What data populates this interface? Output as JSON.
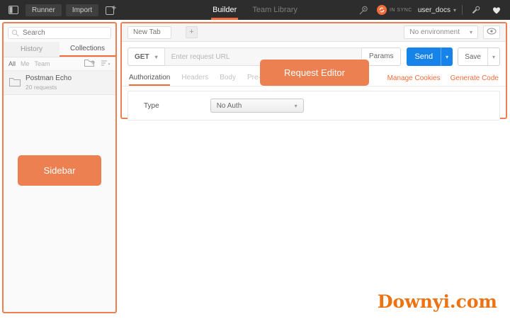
{
  "topbar": {
    "runner_label": "Runner",
    "import_label": "Import",
    "nav_tabs": [
      {
        "label": "Builder",
        "active": true
      },
      {
        "label": "Team Library",
        "active": false
      }
    ],
    "sync_status": "IN SYNC",
    "account_name": "user_docs"
  },
  "sidebar": {
    "search_placeholder": "Search",
    "tabs": [
      {
        "label": "History",
        "active": false
      },
      {
        "label": "Collections",
        "active": true
      }
    ],
    "filters": {
      "all": "All",
      "me": "Me",
      "team": "Team"
    },
    "collection": {
      "name": "Postman Echo",
      "meta": "20 requests"
    },
    "overlay_label": "Sidebar"
  },
  "editor": {
    "tab_label": "New Tab",
    "add_tab_label": "+",
    "environment_label": "No environment",
    "method": "GET",
    "url_placeholder": "Enter request URL",
    "params_label": "Params",
    "send_label": "Send",
    "save_label": "Save",
    "request_tabs": [
      {
        "label": "Authorization",
        "active": true
      },
      {
        "label": "Headers",
        "active": false
      },
      {
        "label": "Body",
        "active": false
      },
      {
        "label": "Pre-request Script",
        "active": false
      }
    ],
    "links": {
      "cookies": "Manage Cookies",
      "code": "Generate Code"
    },
    "auth": {
      "type_label": "Type",
      "type_value": "No Auth"
    },
    "overlay_label": "Request Editor"
  },
  "watermark": "Downyi.com",
  "icons": {
    "caret": "▾"
  },
  "colors": {
    "accent_orange": "#f26b3a",
    "overlay_orange": "#ed8051",
    "send_blue": "#1583e9",
    "topbar_bg": "#2d2d2d"
  }
}
